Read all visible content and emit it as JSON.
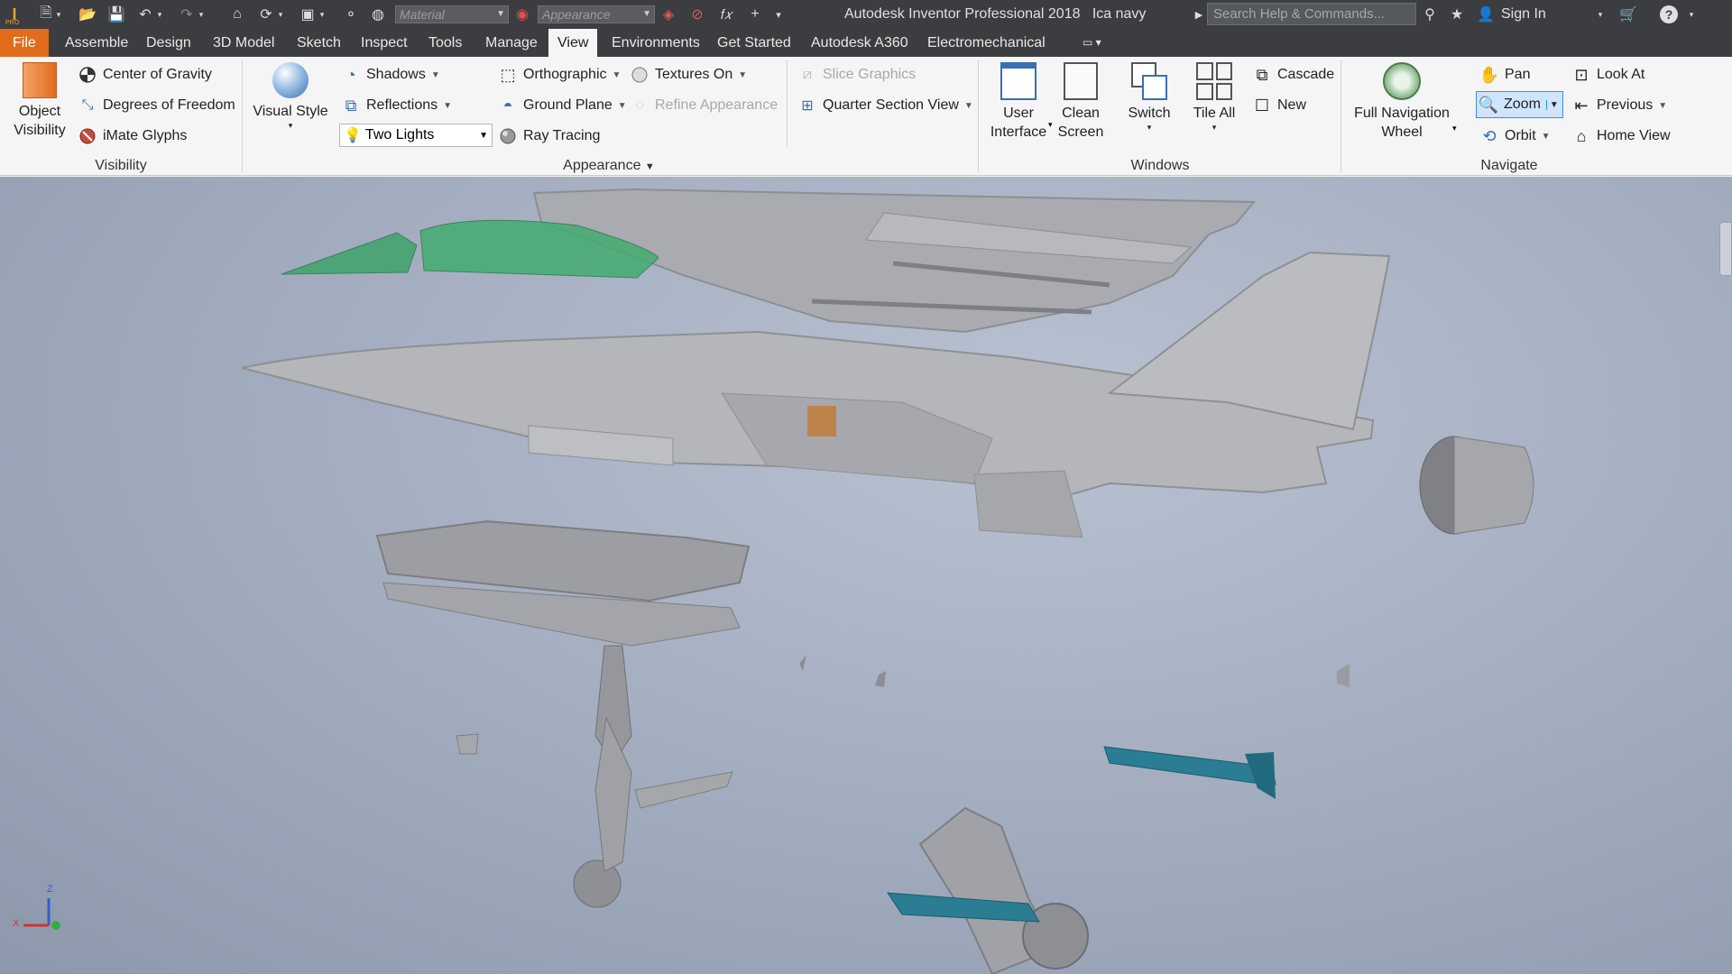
{
  "app": {
    "title": "Autodesk Inventor Professional 2018",
    "document": "Ica navy",
    "badge": "PRO"
  },
  "quickaccess": {
    "material_placeholder": "Material",
    "appearance_placeholder": "Appearance",
    "fx_label": "f𝑥"
  },
  "search": {
    "placeholder": "Search Help & Commands..."
  },
  "account": {
    "sign_in": "Sign In"
  },
  "menu": {
    "tabs": [
      "File",
      "Assemble",
      "Design",
      "3D Model",
      "Sketch",
      "Inspect",
      "Tools",
      "Manage",
      "View",
      "Environments",
      "Get Started",
      "Autodesk A360",
      "Electromechanical"
    ],
    "active": "View"
  },
  "ribbon": {
    "visibility": {
      "object_visibility": "Object Visibility",
      "center_of_gravity": "Center of Gravity",
      "degrees_of_freedom": "Degrees of Freedom",
      "imate_glyphs": "iMate Glyphs",
      "panel": "Visibility"
    },
    "appearance": {
      "visual_style": "Visual Style",
      "shadows": "Shadows",
      "reflections": "Reflections",
      "lighting": "Two Lights",
      "orthographic": "Orthographic",
      "ground_plane": "Ground Plane",
      "ray_tracing": "Ray Tracing",
      "textures": "Textures On",
      "refine_appearance": "Refine Appearance",
      "slice_graphics": "Slice Graphics",
      "quarter_section": "Quarter Section View",
      "panel": "Appearance"
    },
    "windows": {
      "user_interface": "User Interface",
      "clean_screen": "Clean Screen",
      "switch": "Switch",
      "tile_all": "Tile All",
      "cascade": "Cascade",
      "new": "New",
      "panel": "Windows"
    },
    "navigate": {
      "full_nav_wheel": "Full Navigation Wheel",
      "pan": "Pan",
      "zoom": "Zoom",
      "orbit": "Orbit",
      "look_at": "Look At",
      "previous": "Previous",
      "home_view": "Home View",
      "panel": "Navigate"
    }
  },
  "viewport": {
    "axis_z": "Z",
    "axis_x": "X"
  },
  "colors": {
    "accent": "#e06c1c",
    "canopy": "#3fa36a",
    "missile": "#2a7d93",
    "airframe": "#b4b6ba"
  }
}
